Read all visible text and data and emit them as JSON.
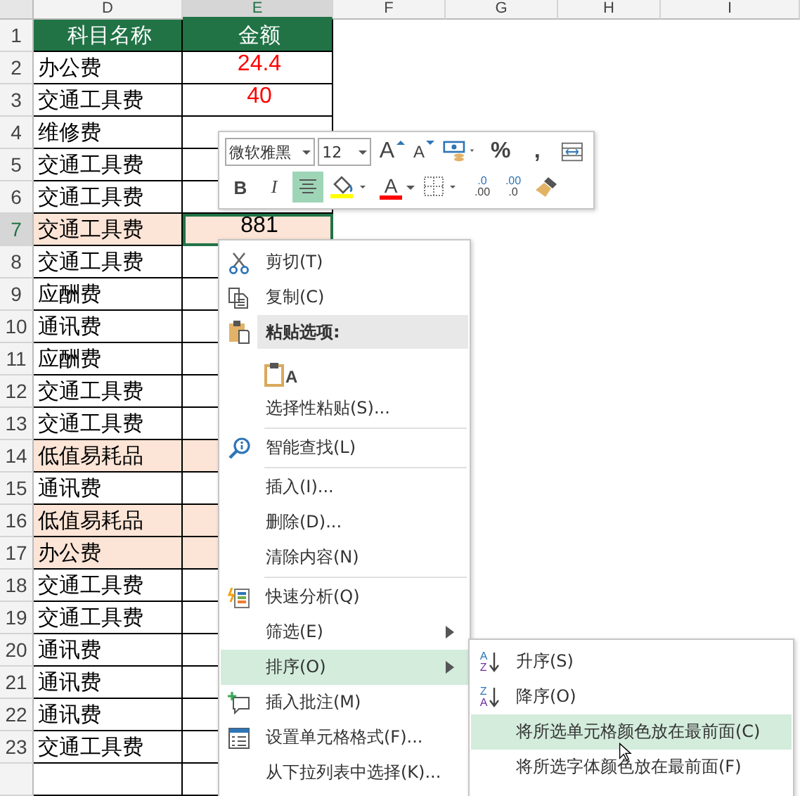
{
  "columns": [
    {
      "label": "D",
      "selected": false
    },
    {
      "label": "E",
      "selected": true
    },
    {
      "label": "F",
      "selected": false
    },
    {
      "label": "G",
      "selected": false
    },
    {
      "label": "H",
      "selected": false
    },
    {
      "label": "I",
      "selected": false
    }
  ],
  "rows": [
    {
      "num": "1",
      "kind": "header",
      "name": "科目名称",
      "amount": "金额",
      "selected": false
    },
    {
      "num": "2",
      "kind": "data",
      "name": "办公费",
      "amount": "24.4",
      "color": "#ff0000",
      "highlight": false,
      "selected": false
    },
    {
      "num": "3",
      "kind": "data",
      "name": "交通工具费",
      "amount": "40",
      "color": "#ff0000",
      "highlight": false,
      "selected": false
    },
    {
      "num": "4",
      "kind": "data",
      "name": "维修费",
      "highlight": false,
      "selected": false
    },
    {
      "num": "5",
      "kind": "data",
      "name": "交通工具费",
      "highlight": false,
      "selected": false
    },
    {
      "num": "6",
      "kind": "data",
      "name": "交通工具费",
      "highlight": false,
      "selected": false
    },
    {
      "num": "7",
      "kind": "data",
      "name": "交通工具费",
      "amount": "881",
      "color": "#000000",
      "highlight": true,
      "selected": true
    },
    {
      "num": "8",
      "kind": "data",
      "name": "交通工具费",
      "highlight": false,
      "selected": false
    },
    {
      "num": "9",
      "kind": "data",
      "name": "应酬费",
      "highlight": false,
      "selected": false
    },
    {
      "num": "10",
      "kind": "data",
      "name": "通讯费",
      "highlight": false,
      "selected": false
    },
    {
      "num": "11",
      "kind": "data",
      "name": "应酬费",
      "highlight": false,
      "selected": false
    },
    {
      "num": "12",
      "kind": "data",
      "name": "交通工具费",
      "highlight": false,
      "selected": false
    },
    {
      "num": "13",
      "kind": "data",
      "name": "交通工具费",
      "highlight": false,
      "selected": false
    },
    {
      "num": "14",
      "kind": "data",
      "name": "低值易耗品",
      "highlight": true,
      "selected": false
    },
    {
      "num": "15",
      "kind": "data",
      "name": "通讯费",
      "highlight": false,
      "selected": false
    },
    {
      "num": "16",
      "kind": "data",
      "name": "低值易耗品",
      "highlight": true,
      "selected": false
    },
    {
      "num": "17",
      "kind": "data",
      "name": "办公费",
      "highlight": true,
      "selected": false
    },
    {
      "num": "18",
      "kind": "data",
      "name": "交通工具费",
      "highlight": false,
      "selected": false
    },
    {
      "num": "19",
      "kind": "data",
      "name": "交通工具费",
      "highlight": false,
      "selected": false
    },
    {
      "num": "20",
      "kind": "data",
      "name": "通讯费",
      "highlight": false,
      "selected": false
    },
    {
      "num": "21",
      "kind": "data",
      "name": "通讯费",
      "highlight": false,
      "selected": false
    },
    {
      "num": "22",
      "kind": "data",
      "name": "通讯费",
      "highlight": false,
      "selected": false
    },
    {
      "num": "23",
      "kind": "data",
      "name": "交通工具费",
      "highlight": false,
      "selected": false
    }
  ],
  "toolbar": {
    "row1": [
      {
        "kind": "font",
        "value": "微软雅黑"
      },
      {
        "kind": "size",
        "value": "12"
      },
      {
        "kind": "grow",
        "label": "A"
      },
      {
        "kind": "shrink",
        "label": "A"
      },
      {
        "kind": "currency"
      },
      {
        "kind": "text",
        "label": "%"
      },
      {
        "kind": "text",
        "label": ","
      },
      {
        "kind": "merge"
      }
    ],
    "row2": [
      {
        "kind": "toggle",
        "label": "B",
        "selected": false
      },
      {
        "kind": "toggle",
        "label": "I",
        "selected": false
      },
      {
        "kind": "align-center",
        "selected": true
      },
      {
        "kind": "fill-color",
        "color": "#ffff00"
      },
      {
        "kind": "font-color",
        "label": "A",
        "color": "#ff0000"
      },
      {
        "kind": "borders"
      },
      {
        "kind": "decimal",
        "top": ".0",
        "bottom": ".00"
      },
      {
        "kind": "decimal",
        "top": ".00",
        "bottom": ".0"
      },
      {
        "kind": "painter"
      }
    ]
  },
  "context_menu": [
    {
      "kind": "item",
      "label": "剪切(T)",
      "submenu": false,
      "selected": false
    },
    {
      "kind": "item",
      "label": "复制(C)",
      "submenu": false,
      "selected": false
    },
    {
      "kind": "header",
      "label": "粘贴选项:"
    },
    {
      "kind": "paste-options",
      "label": "A"
    },
    {
      "kind": "item",
      "label": "选择性粘贴(S)...",
      "submenu": false,
      "selected": false
    },
    {
      "kind": "separator"
    },
    {
      "kind": "item",
      "label": "智能查找(L)",
      "submenu": false,
      "selected": false
    },
    {
      "kind": "separator"
    },
    {
      "kind": "item",
      "label": "插入(I)...",
      "submenu": false,
      "selected": false
    },
    {
      "kind": "item",
      "label": "删除(D)...",
      "submenu": false,
      "selected": false
    },
    {
      "kind": "item",
      "label": "清除内容(N)",
      "submenu": false,
      "selected": false
    },
    {
      "kind": "separator"
    },
    {
      "kind": "item",
      "label": "快速分析(Q)",
      "submenu": false,
      "selected": false
    },
    {
      "kind": "item",
      "label": "筛选(E)",
      "submenu": true,
      "selected": false
    },
    {
      "kind": "item",
      "label": "排序(O)",
      "submenu": true,
      "selected": true
    },
    {
      "kind": "item",
      "label": "插入批注(M)",
      "submenu": false,
      "selected": false
    },
    {
      "kind": "item",
      "label": "设置单元格格式(F)...",
      "submenu": false,
      "selected": false
    },
    {
      "kind": "item",
      "label": "从下拉列表中选择(K)...",
      "submenu": false,
      "selected": false
    }
  ],
  "submenu": [
    {
      "top": "A",
      "bottom": "Z",
      "label": "升序(S)",
      "selected": false
    },
    {
      "top": "Z",
      "bottom": "A",
      "label": "降序(O)",
      "selected": false
    },
    {
      "label": "将所选单元格颜色放在最前面(C)",
      "selected": true
    },
    {
      "label": "将所选字体颜色放在最前面(F)",
      "selected": false
    }
  ]
}
